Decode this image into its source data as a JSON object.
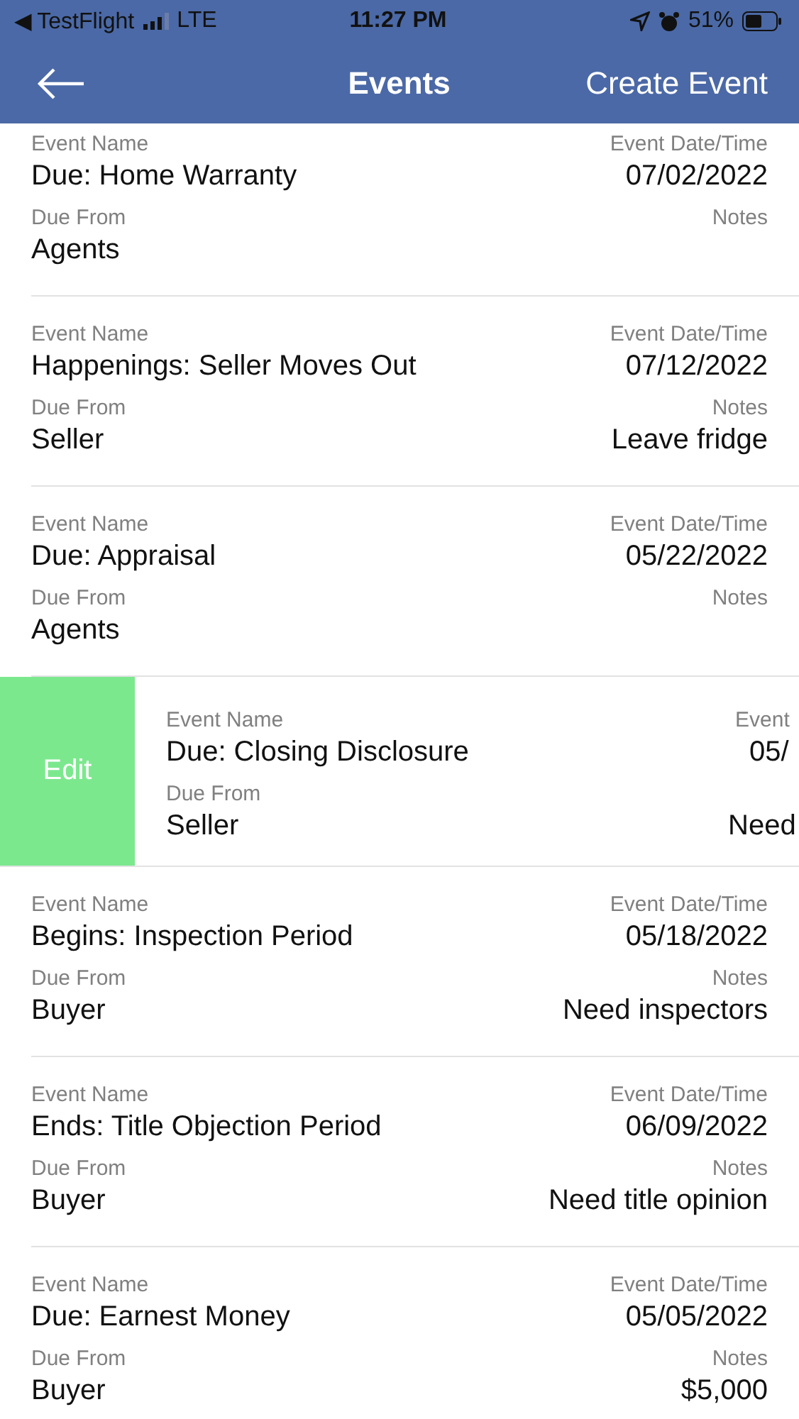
{
  "status_bar": {
    "back_app": "◀ TestFlight",
    "network": "LTE",
    "time": "11:27 PM",
    "battery": "51%"
  },
  "header": {
    "title": "Events",
    "action": "Create Event"
  },
  "events": [
    {
      "kind": "normal",
      "name_label": "Event Name",
      "name": "Due: Home Warranty",
      "date_label": "Event Date/Time",
      "date": "07/02/2022",
      "from_label": "Due From",
      "from": "Agents",
      "notes_label": "Notes"
    },
    {
      "kind": "normal",
      "name_label": "Event Name",
      "name": "Happenings: Seller Moves Out",
      "date_label": "Event Date/Time",
      "date": "07/12/2022",
      "from_label": "Due From",
      "from": "Seller",
      "notes_label": "Notes",
      "notes": "Leave fridge"
    },
    {
      "kind": "normal",
      "name_label": "Event Name",
      "name": "Due: Appraisal",
      "date_label": "Event Date/Time",
      "date": "05/22/2022",
      "from_label": "Due From",
      "from": "Agents",
      "notes_label": "Notes"
    },
    {
      "kind": "swiped",
      "action": "Edit",
      "name_label": "Event Name",
      "name": "Due: Closing Disclosure",
      "date_label": "Event",
      "date": "05/",
      "from_label": "Due From",
      "from": "Seller",
      "notes": "Need"
    },
    {
      "kind": "normal",
      "name_label": "Event Name",
      "name": "Begins: Inspection Period",
      "date_label": "Event Date/Time",
      "date": "05/18/2022",
      "from_label": "Due From",
      "from": "Buyer",
      "notes_label": "Notes",
      "notes": "Need inspectors"
    },
    {
      "kind": "normal",
      "name_label": "Event Name",
      "name": "Ends: Title Objection Period",
      "date_label": "Event Date/Time",
      "date": "06/09/2022",
      "from_label": "Due From",
      "from": "Buyer",
      "notes_label": "Notes",
      "notes": "Need title opinion"
    },
    {
      "kind": "normal",
      "name_label": "Event Name",
      "name": "Due: Earnest Money",
      "date_label": "Event Date/Time",
      "date": "05/05/2022",
      "from_label": "Due From",
      "from": "Buyer",
      "notes_label": "Notes",
      "notes": "$5,000"
    }
  ]
}
